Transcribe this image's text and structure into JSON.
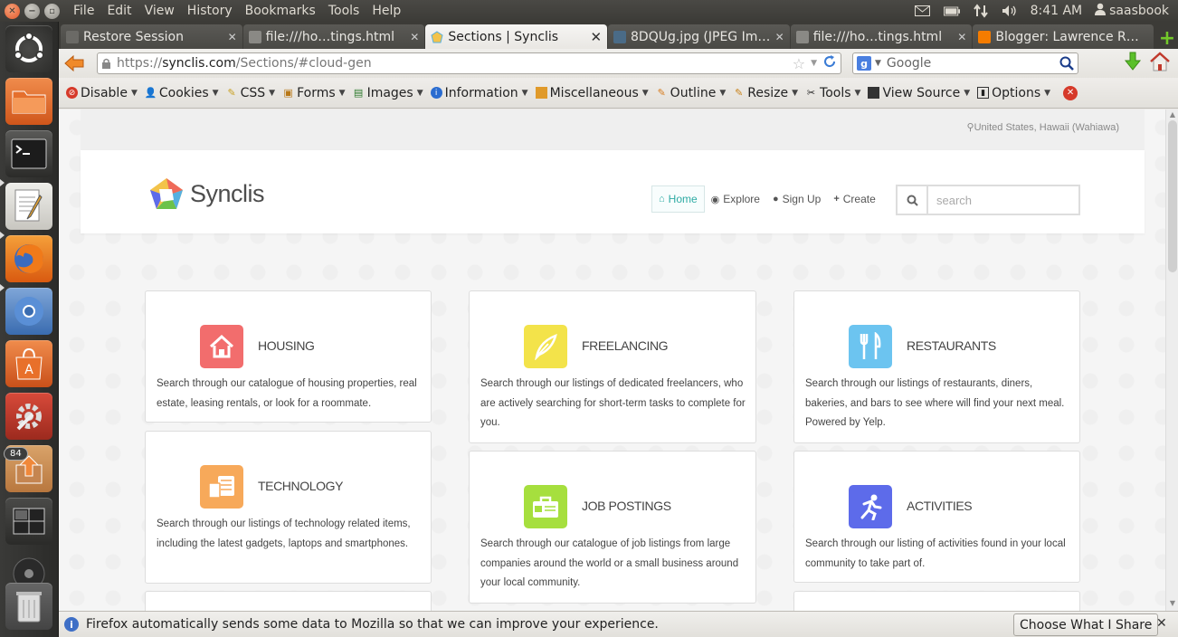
{
  "topbar": {
    "menus": [
      "File",
      "Edit",
      "View",
      "History",
      "Bookmarks",
      "Tools",
      "Help"
    ],
    "time": "8:41 AM",
    "user": "saasbook"
  },
  "launcher": {
    "badge": "84",
    "items": [
      "ubuntu-dash",
      "files",
      "terminal",
      "text-editor",
      "firefox",
      "chromium",
      "software-center",
      "system-settings",
      "update-manager",
      "workspace-switcher",
      "disk",
      "trash"
    ]
  },
  "tabs": [
    {
      "label": "Restore Session",
      "favicon_color": "#6b6a66"
    },
    {
      "label": "file:///ho…tings.html",
      "favicon_color": "#8a8985"
    },
    {
      "label": "Sections | Synclis",
      "favicon_color": "#e8a83a"
    },
    {
      "label": "8DQUg.jpg (JPEG Im…",
      "favicon_color": "#4a6b87"
    },
    {
      "label": "file:///ho…tings.html",
      "favicon_color": "#8a8985"
    },
    {
      "label": "Blogger: Lawrence R…",
      "favicon_color": "#f57c00"
    }
  ],
  "navbar": {
    "url_prefix": "https://",
    "url_host": "synclis.com",
    "url_path": "/Sections/#cloud-gen",
    "search_engine": "Google",
    "search_placeholder": "Google"
  },
  "devbar": {
    "items": [
      "Disable",
      "Cookies",
      "CSS",
      "Forms",
      "Images",
      "Information",
      "Miscellaneous",
      "Outline",
      "Resize",
      "Tools",
      "View Source",
      "Options"
    ]
  },
  "page": {
    "location": "United States, Hawaii (Wahiawa)",
    "logo_text": "Synclis",
    "nav": {
      "home": "Home",
      "explore": "Explore",
      "signup": "Sign Up",
      "create": "Create"
    },
    "search_placeholder": "search",
    "cards": [
      {
        "title": "HOUSING",
        "desc": "Search through our catalogue of housing properties, real estate, leasing rentals, or look for a roommate.",
        "color": "#f26d6d",
        "icon": "house-icon"
      },
      {
        "title": "FREELANCING",
        "desc": "Search through our listings of dedicated freelancers, who are actively searching for short-term tasks to complete for you.",
        "color": "#f3e34a",
        "icon": "feather-icon"
      },
      {
        "title": "RESTAURANTS",
        "desc": "Search through our listings of restaurants, diners, bakeries, and bars to see where will find your next meal. Powered by Yelp.",
        "color": "#6cc4f0",
        "icon": "fork-knife-icon"
      },
      {
        "title": "TECHNOLOGY",
        "desc": "Search through our listings of technology related items, including the latest gadgets, laptops and smartphones.",
        "color": "#f7a95a",
        "icon": "devices-icon"
      },
      {
        "title": "JOB POSTINGS",
        "desc": "Search through our catalogue of job listings from large companies around the world or a small business around your local community.",
        "color": "#a6df3e",
        "icon": "briefcase-icon"
      },
      {
        "title": "ACTIVITIES",
        "desc": "Search through our listing of activities found in your local community to take part of.",
        "color": "#5d6bea",
        "icon": "runner-icon"
      }
    ],
    "partial_card_colors": [
      "#f58a6a",
      "#9a63e6"
    ]
  },
  "notification": {
    "text": "Firefox automatically sends some data to Mozilla so that we can improve your experience.",
    "button": "Choose What I Share"
  }
}
